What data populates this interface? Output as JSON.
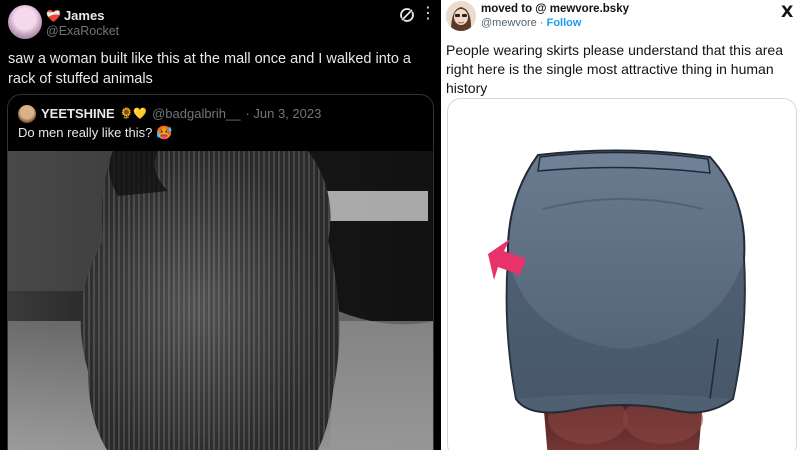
{
  "left_tweet": {
    "author_name": "James",
    "author_handle": "@ExaRocket",
    "name_badge": "❤️‍🩹",
    "more_icon": "more-icon",
    "text": "saw a woman built like this at the mall once and I walked into a rack of stuffed animals",
    "quoted": {
      "author_name": "YEETSHINE",
      "name_emojis": "🌻💛",
      "author_handle": "@badgalbrih__",
      "date": "· Jun 3, 2023",
      "text": "Do men really like this? 🥵"
    }
  },
  "right_tweet": {
    "author_name": "moved to @ mewvore.bsky",
    "author_handle": "@mewvore",
    "separator": "·",
    "follow_label": "Follow",
    "text": "People wearing skirts please understand that this area right here is the single most attractive thing in human history",
    "logo": "X",
    "colors": {
      "follow": "#1d9bf0",
      "skirt": "#5e6f84",
      "tights": "#5c2a2a",
      "arrow": "#e8336a"
    }
  }
}
